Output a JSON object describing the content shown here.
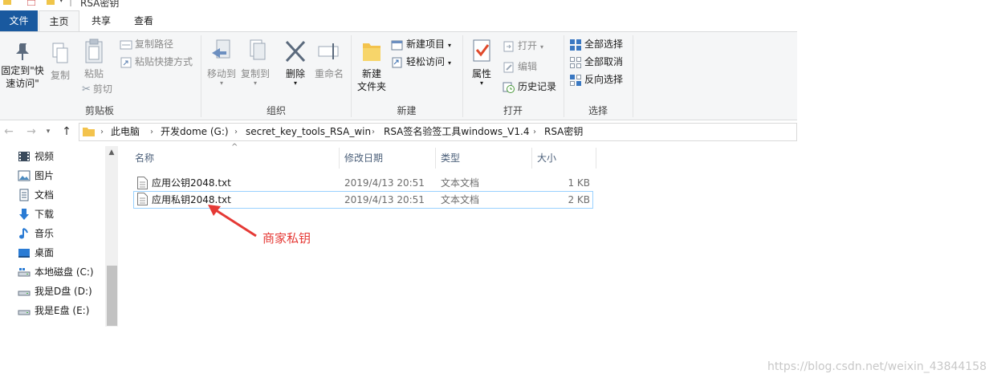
{
  "window": {
    "title": "RSA密钥"
  },
  "ribbon_tabs": [
    "文件",
    "主页",
    "共享",
    "查看"
  ],
  "ribbon": {
    "clipboard": {
      "label": "剪贴板",
      "pin_line1": "固定到\"快",
      "pin_line2": "速访问\"",
      "copy": "复制",
      "paste": "粘贴",
      "copy_path": "复制路径",
      "paste_shortcut": "粘贴快捷方式",
      "cut": "剪切"
    },
    "organize": {
      "label": "组织",
      "move_to": "移动到",
      "copy_to": "复制到",
      "delete": "删除",
      "rename": "重命名"
    },
    "new": {
      "label": "新建",
      "new_folder_line1": "新建",
      "new_folder_line2": "文件夹",
      "new_item": "新建项目",
      "easy_access": "轻松访问"
    },
    "open": {
      "label": "打开",
      "properties": "属性",
      "open": "打开",
      "edit": "编辑",
      "history": "历史记录"
    },
    "select": {
      "label": "选择",
      "select_all": "全部选择",
      "select_none": "全部取消",
      "invert": "反向选择"
    }
  },
  "address": {
    "breadcrumbs": [
      "此电脑",
      "开发dome (G:)",
      "secret_key_tools_RSA_win",
      "RSA签名验签工具windows_V1.4",
      "RSA密钥"
    ]
  },
  "nav_pane": {
    "items": [
      {
        "label": "视频",
        "icon": "video-icon"
      },
      {
        "label": "图片",
        "icon": "picture-icon"
      },
      {
        "label": "文档",
        "icon": "document-icon"
      },
      {
        "label": "下载",
        "icon": "download-icon"
      },
      {
        "label": "音乐",
        "icon": "music-icon"
      },
      {
        "label": "桌面",
        "icon": "desktop-icon"
      },
      {
        "label": "本地磁盘 (C:)",
        "icon": "drive-icon"
      },
      {
        "label": "我是D盘 (D:)",
        "icon": "drive-icon"
      },
      {
        "label": "我是E盘 (E:)",
        "icon": "drive-icon"
      }
    ]
  },
  "file_list": {
    "columns": [
      "名称",
      "修改日期",
      "类型",
      "大小"
    ],
    "rows": [
      {
        "name": "应用公钥2048.txt",
        "modified": "2019/4/13 20:51",
        "type": "文本文档",
        "size": "1 KB"
      },
      {
        "name": "应用私钥2048.txt",
        "modified": "2019/4/13 20:51",
        "type": "文本文档",
        "size": "2 KB"
      }
    ]
  },
  "annotation": {
    "text": "商家私钥",
    "color": "#e53935"
  },
  "watermark": "https://blog.csdn.net/weixin_43844158",
  "colors": {
    "file_tab": "#19599f",
    "ribbon_bg": "#f5f6f7",
    "selection_border": "#99d1ff",
    "header_text": "#4c607a"
  }
}
